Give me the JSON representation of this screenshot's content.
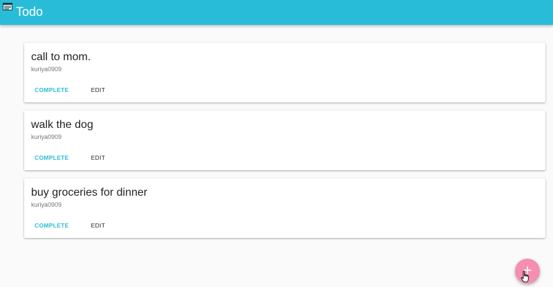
{
  "app": {
    "title": "Todo",
    "icon": "app-window-icon",
    "accent_color": "#29bcd9",
    "fab_color": "#f48fb1"
  },
  "todos": [
    {
      "title": "call to mom.",
      "user": "kuriya0909",
      "complete_label": "COMPLETE",
      "edit_label": "EDIT"
    },
    {
      "title": "walk the dog",
      "user": "kuriya0909",
      "complete_label": "COMPLETE",
      "edit_label": "EDIT"
    },
    {
      "title": "buy groceries for dinner",
      "user": "kuriya0909",
      "complete_label": "COMPLETE",
      "edit_label": "EDIT"
    }
  ],
  "fab": {
    "icon": "plus-icon",
    "symbol": "+"
  }
}
